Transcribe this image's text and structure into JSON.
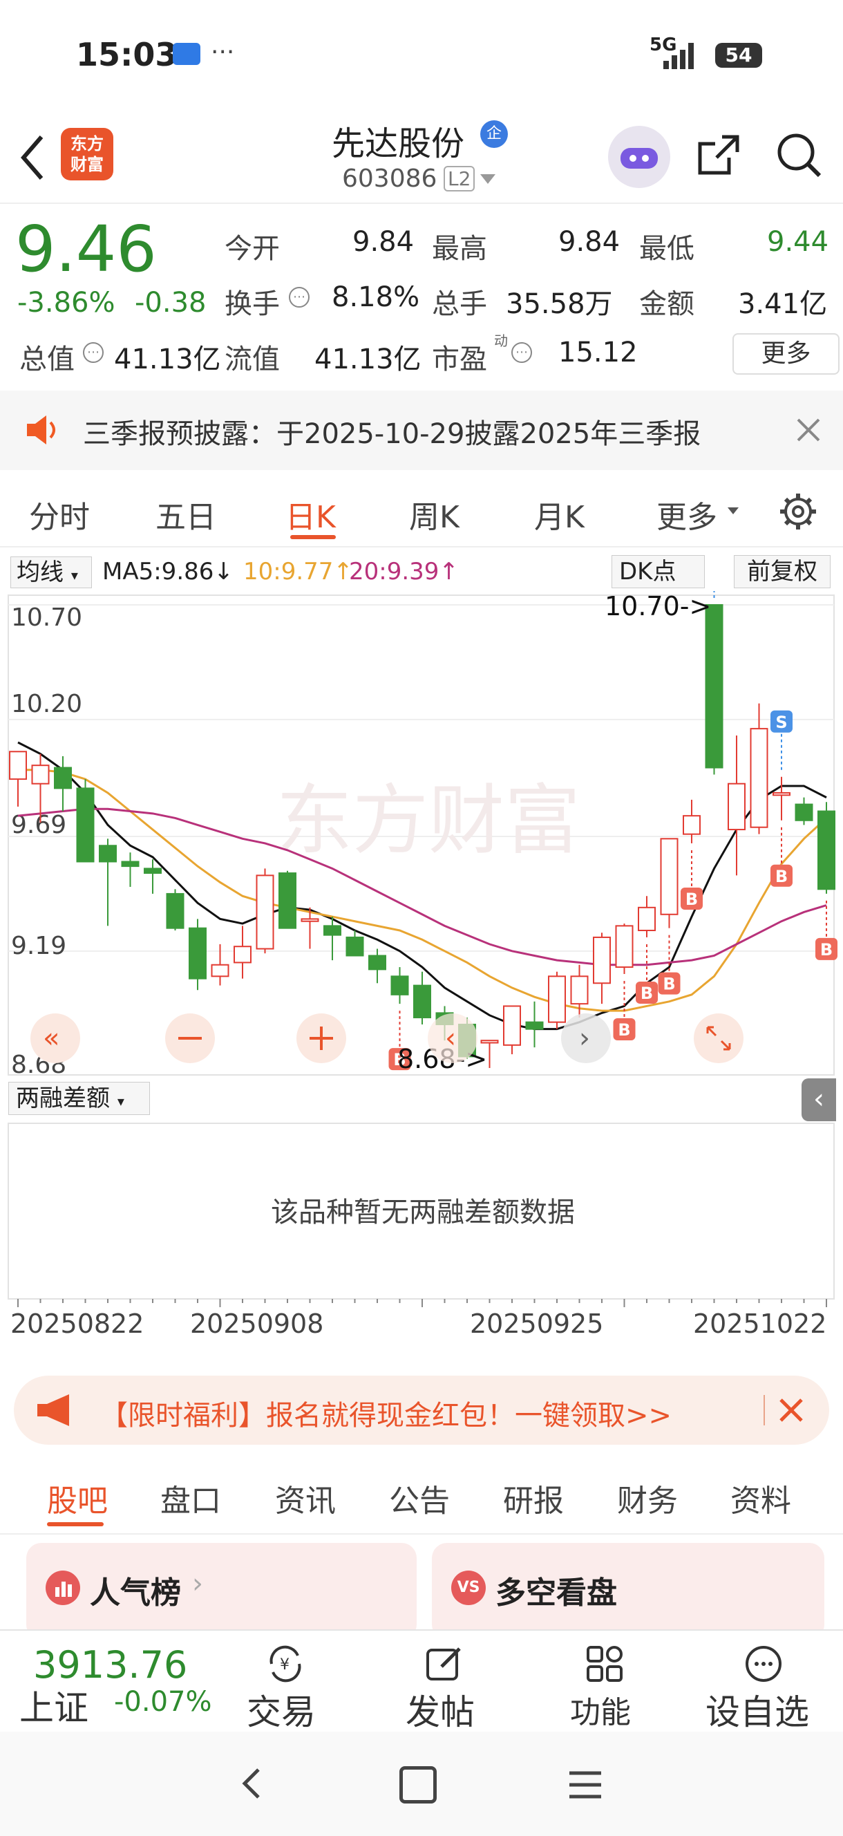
{
  "status": {
    "time": "15:03",
    "dots": "···",
    "network": "5G",
    "battery": "54"
  },
  "nav": {
    "logo_line1": "东方",
    "logo_line2": "财富",
    "stock_name": "先达股份",
    "badge": "企",
    "stock_code": "603086",
    "level": "L2"
  },
  "quote": {
    "price": "9.46",
    "change_pct": "-3.86%",
    "change": "-0.38",
    "labels": {
      "open": "今开",
      "high": "最高",
      "low": "最低",
      "turnover": "换手",
      "volume": "总手",
      "amount": "金额",
      "mcap": "总值",
      "float": "流值",
      "pe": "市盈",
      "pe_sup": "动"
    },
    "values": {
      "open": "9.84",
      "high": "9.84",
      "low": "9.44",
      "turnover": "8.18%",
      "volume": "35.58万",
      "amount": "3.41亿",
      "mcap": "41.13亿",
      "float": "41.13亿",
      "pe": "15.12"
    },
    "more": "更多"
  },
  "notice": {
    "text": "三季报预披露：于2025-10-29披露2025年三季报"
  },
  "tabs": [
    "分时",
    "五日",
    "日K",
    "周K",
    "月K",
    "更多"
  ],
  "chart_header": {
    "ma_select": "均线",
    "ma5": "MA5:9.86",
    "ma10": "10:9.77",
    "ma20": "20:9.39",
    "dk": "DK点",
    "adjust": "前复权"
  },
  "chart_labels": {
    "y1": "10.70",
    "y2": "10.20",
    "y3": "9.69",
    "y4": "9.19",
    "y5": "8.68",
    "max_label": "10.70->",
    "min_label": "8.68->",
    "sub_select": "两融差额",
    "empty": "该品种暂无两融差额数据",
    "watermark": "东方财富"
  },
  "x_dates": [
    "20250822",
    "20250908",
    "20250925",
    "20251022"
  ],
  "chart_data": {
    "type": "candlestick",
    "ylim": [
      8.68,
      10.7
    ],
    "candles": [
      {
        "o": 9.94,
        "h": 10.02,
        "l": 9.82,
        "c": 10.06
      },
      {
        "o": 9.92,
        "h": 10.05,
        "l": 9.75,
        "c": 10.0
      },
      {
        "o": 9.99,
        "h": 10.04,
        "l": 9.8,
        "c": 9.9
      },
      {
        "o": 9.9,
        "h": 9.94,
        "l": 9.62,
        "c": 9.58
      },
      {
        "o": 9.65,
        "h": 9.68,
        "l": 9.3,
        "c": 9.58
      },
      {
        "o": 9.58,
        "h": 9.62,
        "l": 9.47,
        "c": 9.56
      },
      {
        "o": 9.55,
        "h": 9.59,
        "l": 9.44,
        "c": 9.53
      },
      {
        "o": 9.44,
        "h": 9.46,
        "l": 9.28,
        "c": 9.29
      },
      {
        "o": 9.29,
        "h": 9.33,
        "l": 9.02,
        "c": 9.07
      },
      {
        "o": 9.08,
        "h": 9.22,
        "l": 9.04,
        "c": 9.13
      },
      {
        "o": 9.14,
        "h": 9.3,
        "l": 9.07,
        "c": 9.21
      },
      {
        "o": 9.2,
        "h": 9.55,
        "l": 9.18,
        "c": 9.52
      },
      {
        "o": 9.53,
        "h": 9.54,
        "l": 9.3,
        "c": 9.29
      },
      {
        "o": 9.32,
        "h": 9.38,
        "l": 9.2,
        "c": 9.33
      },
      {
        "o": 9.3,
        "h": 9.34,
        "l": 9.15,
        "c": 9.26
      },
      {
        "o": 9.25,
        "h": 9.28,
        "l": 9.17,
        "c": 9.17
      },
      {
        "o": 9.17,
        "h": 9.2,
        "l": 9.05,
        "c": 9.11
      },
      {
        "o": 9.08,
        "h": 9.12,
        "l": 8.96,
        "c": 9.0
      },
      {
        "o": 9.04,
        "h": 9.1,
        "l": 8.87,
        "c": 8.9
      },
      {
        "o": 8.92,
        "h": 8.95,
        "l": 8.8,
        "c": 8.87
      },
      {
        "o": 8.87,
        "h": 8.9,
        "l": 8.72,
        "c": 8.73
      },
      {
        "o": 8.79,
        "h": 8.68,
        "l": 8.68,
        "c": 8.8
      },
      {
        "o": 8.78,
        "h": 8.95,
        "l": 8.74,
        "c": 8.95
      },
      {
        "o": 8.88,
        "h": 8.97,
        "l": 8.77,
        "c": 8.85
      },
      {
        "o": 8.88,
        "h": 9.1,
        "l": 8.85,
        "c": 9.08
      },
      {
        "o": 8.96,
        "h": 9.13,
        "l": 8.9,
        "c": 9.08
      },
      {
        "o": 9.05,
        "h": 9.27,
        "l": 8.96,
        "c": 9.25
      },
      {
        "o": 9.12,
        "h": 9.31,
        "l": 9.09,
        "c": 9.3
      },
      {
        "o": 9.28,
        "h": 9.43,
        "l": 9.25,
        "c": 9.38
      },
      {
        "o": 9.35,
        "h": 9.68,
        "l": 9.29,
        "c": 9.68
      },
      {
        "o": 9.7,
        "h": 9.85,
        "l": 9.66,
        "c": 9.78
      },
      {
        "o": 10.7,
        "h": 10.7,
        "l": 9.96,
        "c": 9.99
      },
      {
        "o": 9.72,
        "h": 10.13,
        "l": 9.52,
        "c": 9.92
      },
      {
        "o": 9.73,
        "h": 10.27,
        "l": 9.7,
        "c": 10.16
      },
      {
        "o": 9.87,
        "h": 9.95,
        "l": 9.76,
        "c": 9.88
      },
      {
        "o": 9.83,
        "h": 9.86,
        "l": 9.74,
        "c": 9.76
      },
      {
        "o": 9.8,
        "h": 9.84,
        "l": 9.44,
        "c": 9.46
      }
    ],
    "series": [
      {
        "name": "MA5",
        "values": [
          10.1,
          10.05,
          9.98,
          9.88,
          9.74,
          9.65,
          9.6,
          9.5,
          9.4,
          9.33,
          9.31,
          9.35,
          9.38,
          9.37,
          9.33,
          9.28,
          9.24,
          9.19,
          9.12,
          9.03,
          8.97,
          8.91,
          8.87,
          8.85,
          8.85,
          8.88,
          8.92,
          8.95,
          9.05,
          9.12,
          9.34,
          9.55,
          9.72,
          9.85,
          9.91,
          9.91,
          9.86
        ]
      },
      {
        "name": "MA10",
        "values": [
          9.98,
          9.98,
          9.97,
          9.94,
          9.88,
          9.8,
          9.72,
          9.64,
          9.56,
          9.49,
          9.43,
          9.4,
          9.38,
          9.36,
          9.34,
          9.32,
          9.3,
          9.28,
          9.24,
          9.19,
          9.14,
          9.08,
          9.03,
          8.99,
          8.96,
          8.94,
          8.93,
          8.93,
          8.95,
          8.97,
          9.0,
          9.08,
          9.22,
          9.4,
          9.57,
          9.68,
          9.77
        ]
      },
      {
        "name": "MA20",
        "values": [
          9.78,
          9.79,
          9.8,
          9.81,
          9.81,
          9.8,
          9.79,
          9.77,
          9.74,
          9.71,
          9.68,
          9.66,
          9.63,
          9.59,
          9.55,
          9.5,
          9.45,
          9.4,
          9.35,
          9.3,
          9.26,
          9.22,
          9.19,
          9.17,
          9.15,
          9.14,
          9.13,
          9.13,
          9.13,
          9.14,
          9.15,
          9.17,
          9.22,
          9.27,
          9.32,
          9.36,
          9.39
        ]
      }
    ],
    "signals": [
      {
        "i": 17,
        "t": "B"
      },
      {
        "i": 27,
        "t": "B"
      },
      {
        "i": 28,
        "t": "B"
      },
      {
        "i": 29,
        "t": "B"
      },
      {
        "i": 30,
        "t": "B"
      },
      {
        "i": 31,
        "t": "S"
      },
      {
        "i": 34,
        "t": "S"
      },
      {
        "i": 34,
        "t": "B"
      },
      {
        "i": 38,
        "t": "B"
      }
    ],
    "colors": {
      "up": "#e23b32",
      "down": "#3a9a3a",
      "ma5": "#111111",
      "ma10": "#e8a531",
      "ma20": "#b8317a"
    }
  },
  "ad": {
    "text": "【限时福利】报名就得现金红包！一键领取>>"
  },
  "bottom_tabs": [
    "股吧",
    "盘口",
    "资讯",
    "公告",
    "研报",
    "财务",
    "资料"
  ],
  "cards": {
    "left": "人气榜",
    "right": "多空看盘"
  },
  "footer": {
    "index_value": "3913.76",
    "index_name": "上证",
    "index_change": "-0.07%",
    "items": [
      "交易",
      "发帖",
      "功能",
      "设自选"
    ]
  }
}
